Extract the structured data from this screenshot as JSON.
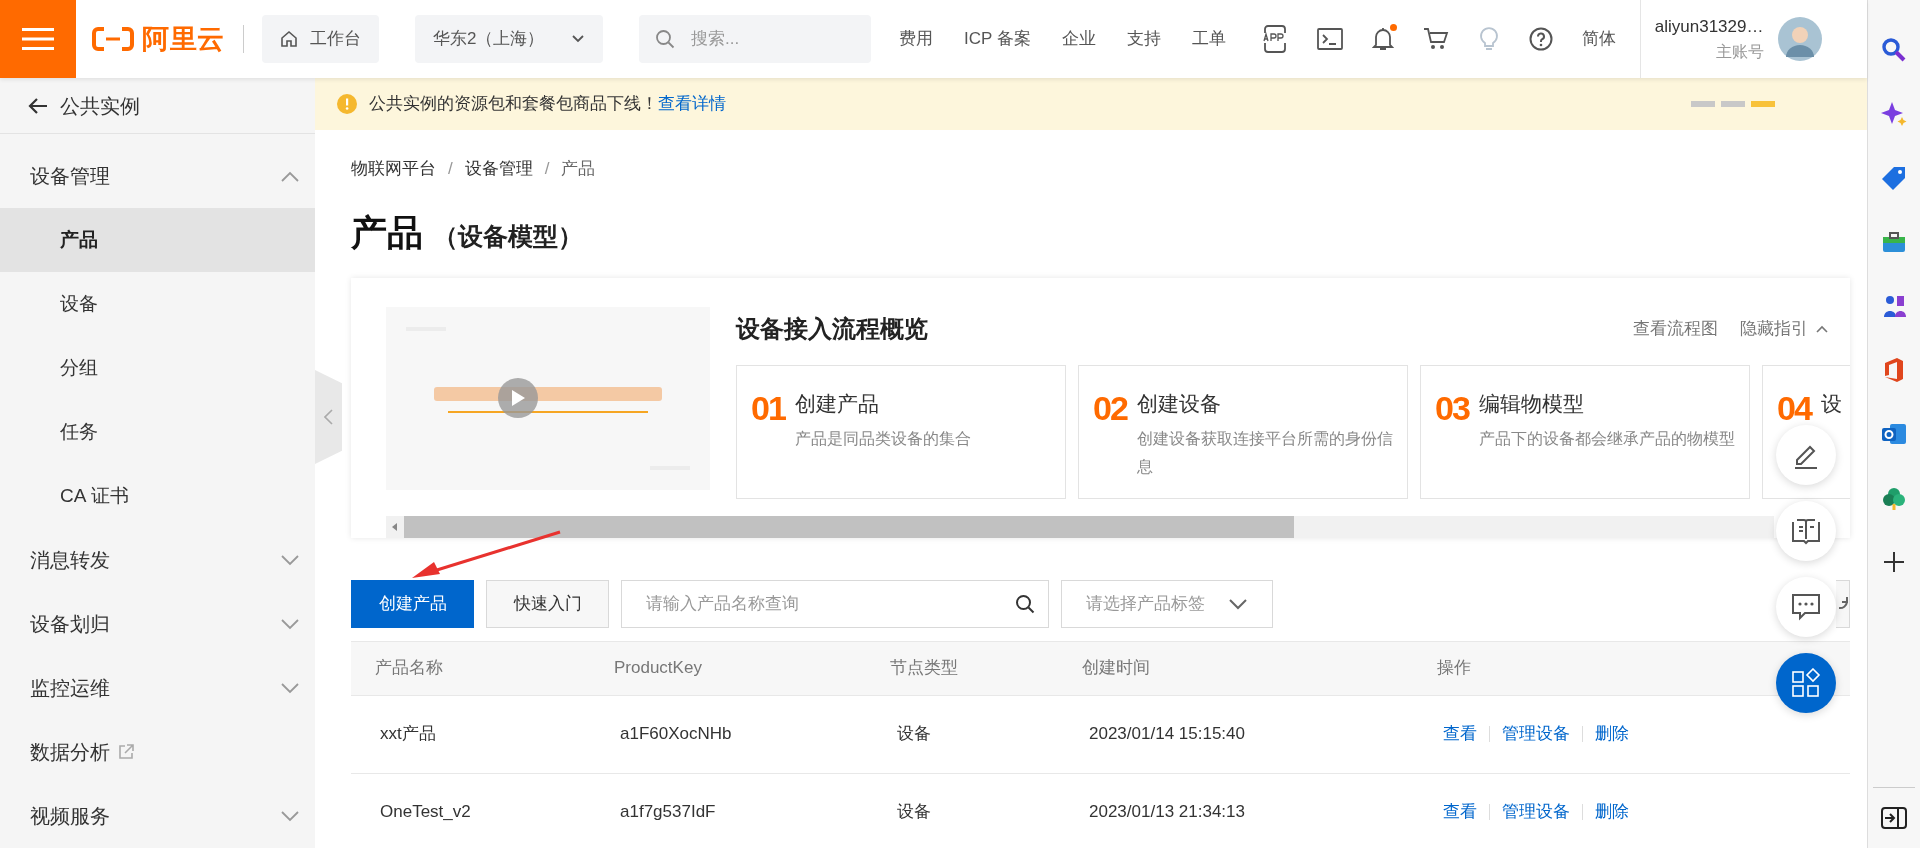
{
  "header": {
    "logo_text": "阿里云",
    "workbench": "工作台",
    "region": "华东2（上海）",
    "search": {
      "placeholder": "搜索..."
    },
    "nav": [
      "费用",
      "ICP 备案",
      "企业",
      "支持",
      "工单"
    ],
    "bell": {
      "has_notification": true
    },
    "language": "简体",
    "user": {
      "name": "aliyun31329…",
      "role": "主账号"
    }
  },
  "sidebar": {
    "back": "公共实例",
    "items": [
      {
        "label": "设备管理",
        "kind": "group",
        "expanded": true,
        "children": [
          {
            "label": "产品",
            "selected": true
          },
          {
            "label": "设备",
            "selected": false
          },
          {
            "label": "分组",
            "selected": false
          },
          {
            "label": "任务",
            "selected": false
          },
          {
            "label": "CA 证书",
            "selected": false
          }
        ]
      },
      {
        "label": "消息转发",
        "kind": "group",
        "expanded": false
      },
      {
        "label": "设备划归",
        "kind": "group",
        "expanded": false
      },
      {
        "label": "监控运维",
        "kind": "group",
        "expanded": false
      },
      {
        "label": "数据分析",
        "kind": "external"
      },
      {
        "label": "视频服务",
        "kind": "group",
        "expanded": false
      }
    ]
  },
  "notice": {
    "text": "公共实例的资源包和套餐包商品下线！",
    "link": "查看详情",
    "slides": [
      {
        "selected": false
      },
      {
        "selected": false
      },
      {
        "selected": true
      }
    ]
  },
  "breadcrumb": [
    {
      "kind": "link",
      "text": "物联网平台"
    },
    {
      "kind": "separator",
      "text": "/"
    },
    {
      "kind": "link",
      "text": "设备管理"
    },
    {
      "kind": "separator",
      "text": "/"
    },
    {
      "kind": "current",
      "text": "产品"
    }
  ],
  "title": "产品",
  "subtitle": "（设备模型）",
  "guide": {
    "video": {
      "kind": "picture"
    },
    "heading": "设备接入流程概览",
    "links": [
      "查看流程图",
      "隐藏指引"
    ],
    "expanded": true,
    "steps": [
      {
        "number": "01",
        "title": "创建产品",
        "description": "产品是同品类设备的集合"
      },
      {
        "number": "02",
        "title": "创建设备",
        "description": "创建设备获取连接平台所需的身份信息"
      },
      {
        "number": "03",
        "title": "编辑物模型",
        "description": "产品下的设备都会继承产品的物模型"
      },
      {
        "number": "04",
        "title": "设"
      }
    ]
  },
  "toolbar": {
    "create": "创建产品",
    "quick_start": "快速入门",
    "search": {
      "placeholder": "请输入产品名称查询"
    },
    "tag_select": {
      "placeholder": "请选择产品标签"
    }
  },
  "table": {
    "columns": [
      "产品名称",
      "ProductKey",
      "节点类型",
      "创建时间",
      "操作"
    ],
    "rows": [
      {
        "name": "xxt产品",
        "key": "a1F60XocNHb",
        "node_type": "设备",
        "created": "2023/01/14 15:15:40",
        "actions": [
          "查看",
          "管理设备",
          "删除"
        ]
      },
      {
        "name": "OneTest_v2",
        "key": "a1f7g537IdF",
        "node_type": "设备",
        "created": "2023/01/13 21:34:13",
        "actions": [
          "查看",
          "管理设备",
          "删除"
        ]
      }
    ]
  }
}
